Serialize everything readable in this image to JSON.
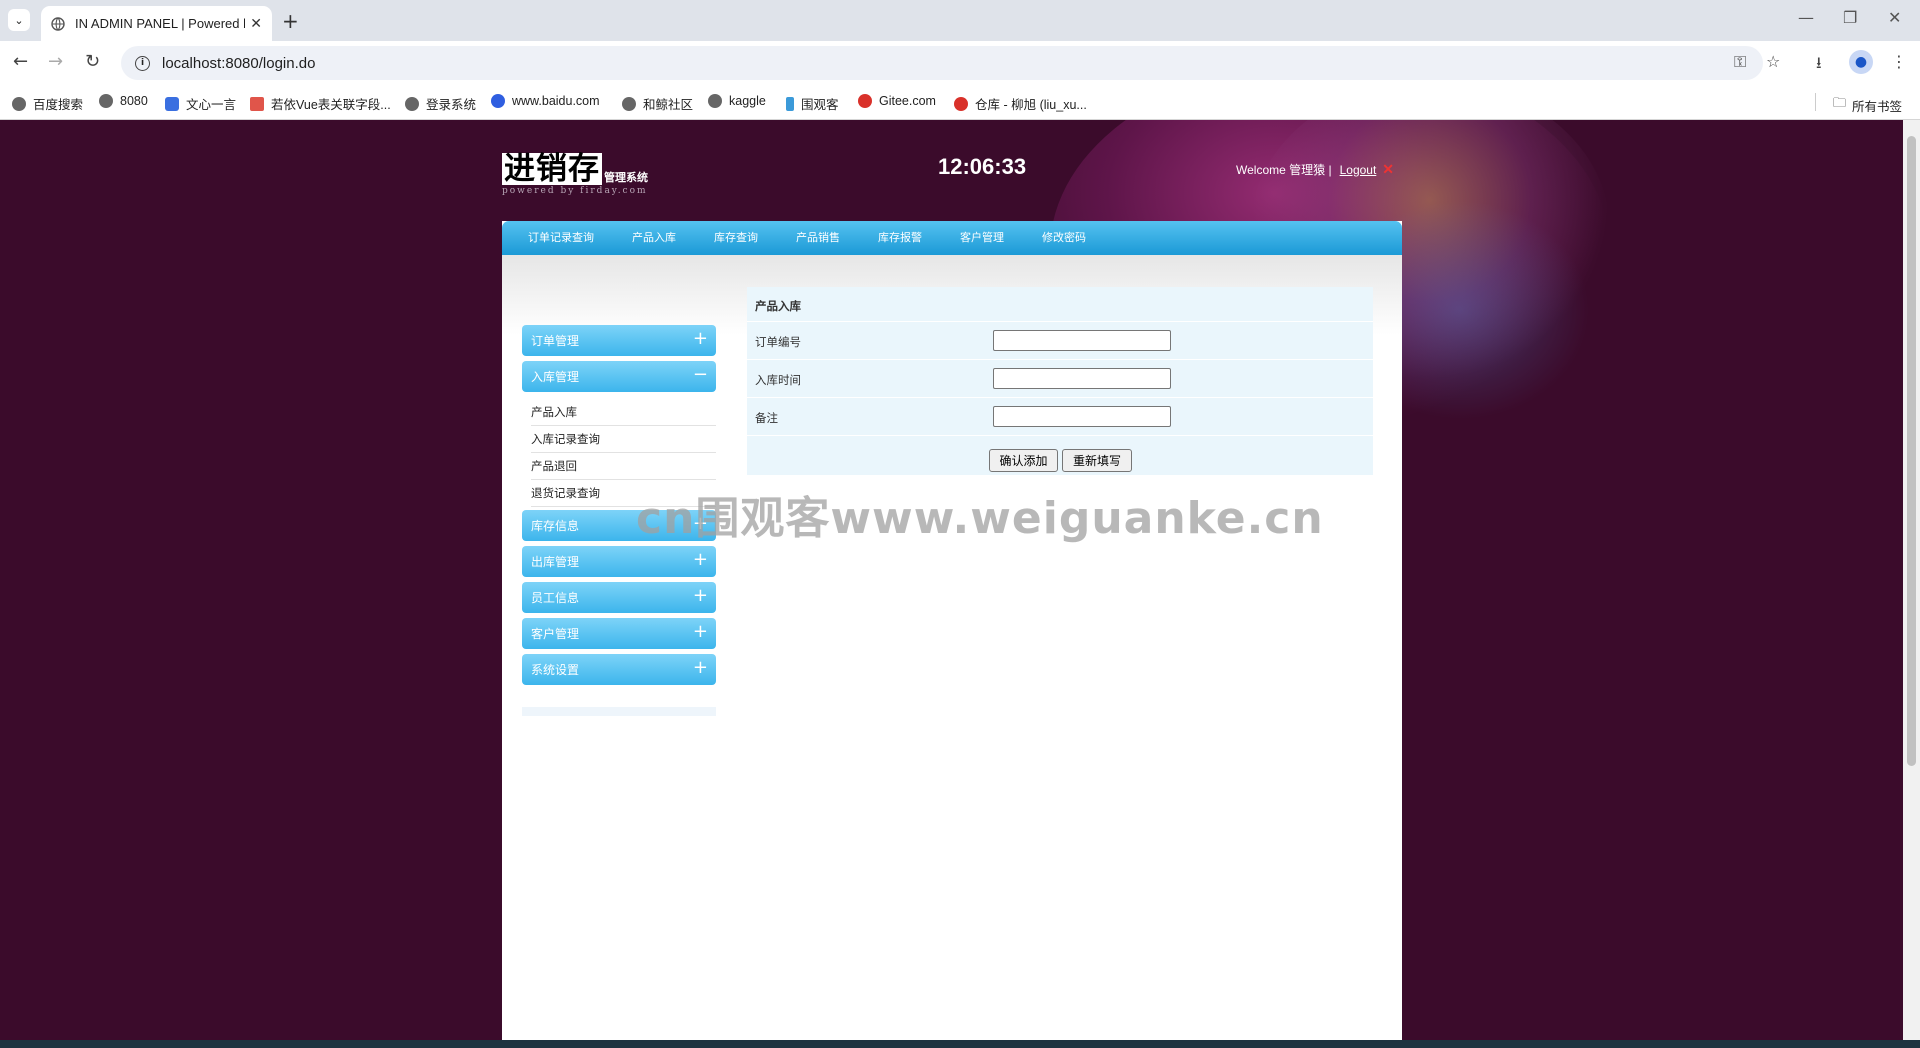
{
  "browser": {
    "tab_title": "IN ADMIN PANEL | Powered b",
    "url": "localhost:8080/login.do",
    "bookmarks": [
      "百度搜索",
      "8080",
      "文心一言",
      "若依Vue表关联字段...",
      "登录系统",
      "www.baidu.com",
      "和鲸社区",
      "kaggle",
      "围观客",
      "Gitee.com",
      "仓库 - 柳旭 (liu_xu..."
    ],
    "all_bookmarks": "所有书签"
  },
  "header": {
    "logo_main": "进销存",
    "logo_sub": "管理系统",
    "logo_powered": "powered by firday.com",
    "clock": "12:06:33",
    "welcome": "Welcome 管理猿 |",
    "logout": "Logout"
  },
  "top_menu": [
    "订单记录查询",
    "产品入库",
    "库存查询",
    "产品销售",
    "库存报警",
    "客户管理",
    "修改密码"
  ],
  "sidebar": {
    "sections_top": [
      {
        "label": "订单管理",
        "sign": "+"
      },
      {
        "label": "入库管理",
        "sign": "−"
      }
    ],
    "sub_items": [
      "产品入库",
      "入库记录查询",
      "产品退回",
      "退货记录查询"
    ],
    "sections_bottom": [
      {
        "label": "库存信息",
        "sign": "+"
      },
      {
        "label": "出库管理",
        "sign": "+"
      },
      {
        "label": "员工信息",
        "sign": "+"
      },
      {
        "label": "客户管理",
        "sign": "+"
      },
      {
        "label": "系统设置",
        "sign": "+"
      }
    ]
  },
  "form": {
    "title": "产品入库",
    "fields": [
      {
        "label": "订单编号",
        "value": ""
      },
      {
        "label": "入库时间",
        "value": ""
      },
      {
        "label": "备注",
        "value": ""
      }
    ],
    "submit": "确认添加",
    "reset": "重新填写"
  },
  "watermark": "cn围观客www.weiguanke.cn"
}
